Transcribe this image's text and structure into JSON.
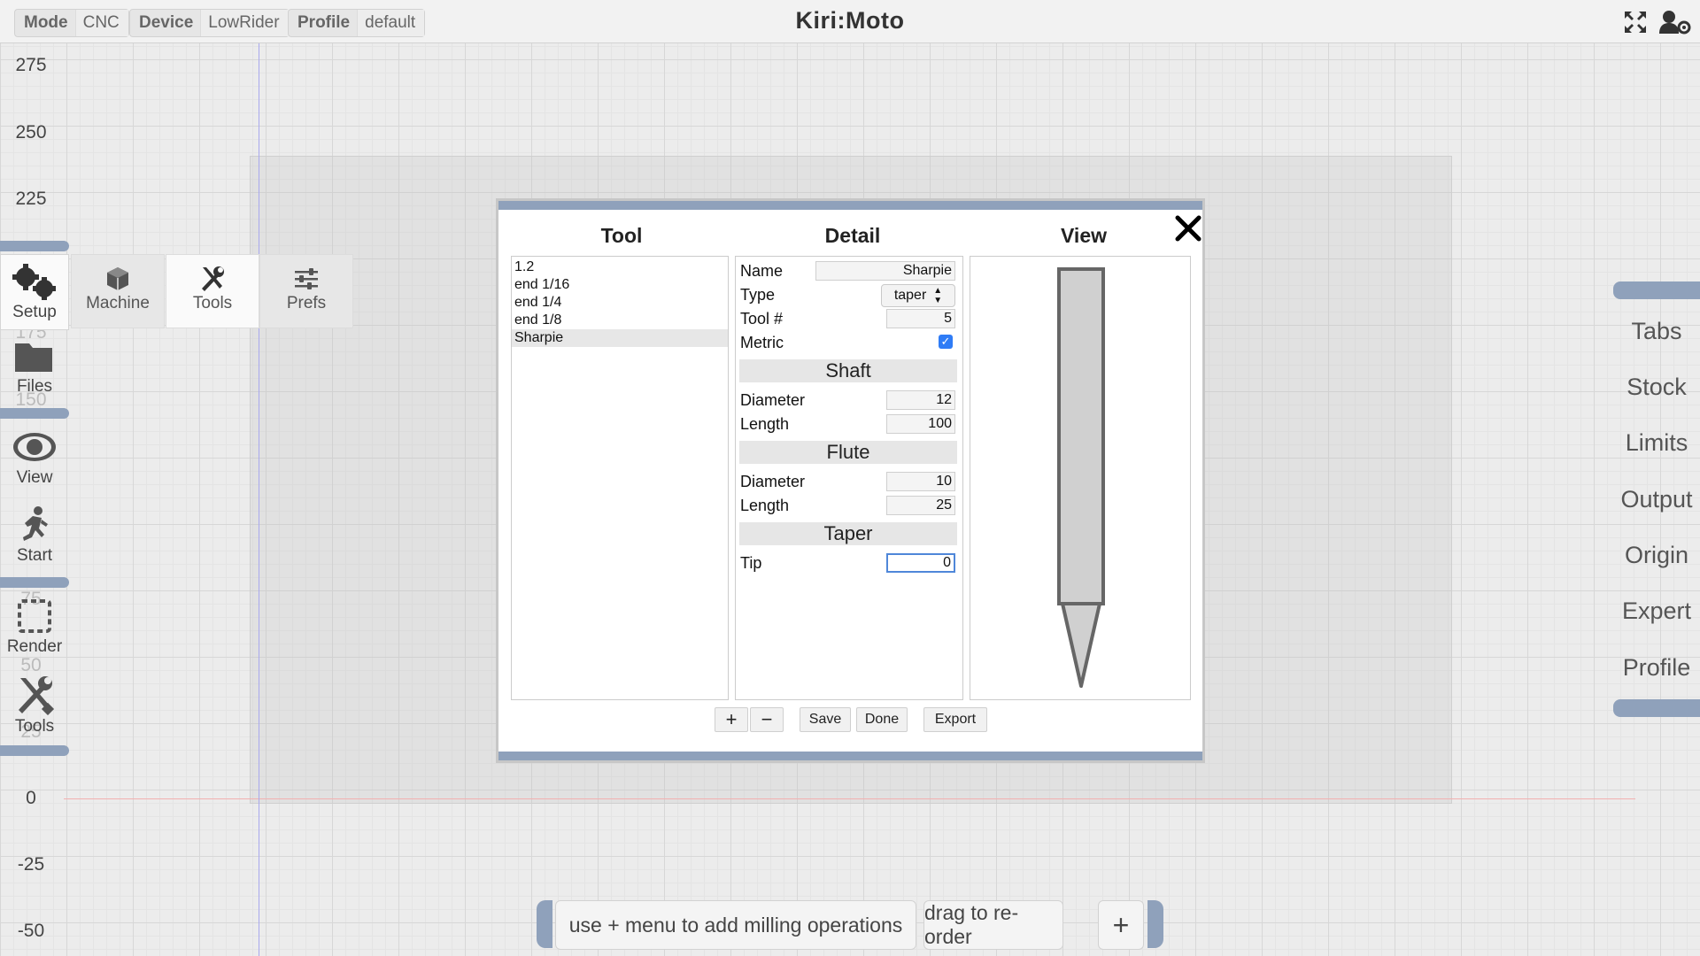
{
  "app": {
    "title": "Kiri:Moto"
  },
  "topbar": {
    "mode": {
      "label": "Mode",
      "value": "CNC"
    },
    "device": {
      "label": "Device",
      "value": "LowRider"
    },
    "profile": {
      "label": "Profile",
      "value": "default"
    },
    "icons": [
      "fullscreen-icon",
      "user-settings-icon"
    ]
  },
  "ruler": {
    "labels": [
      "275",
      "250",
      "225",
      "0",
      "-25",
      "-50"
    ],
    "hidden_labels": [
      "175",
      "150",
      "75",
      "50",
      "25"
    ]
  },
  "left_menu": [
    {
      "label": "Setup",
      "icon": "gears-icon"
    },
    {
      "label": "Files",
      "icon": "folder-icon"
    },
    {
      "label": "View",
      "icon": "eye-icon"
    },
    {
      "label": "Start",
      "icon": "running-person-icon"
    },
    {
      "label": "Render",
      "icon": "render-icon"
    },
    {
      "label": "Tools",
      "icon": "wrench-screwdriver-icon"
    }
  ],
  "setup_submenu": [
    {
      "label": "Machine",
      "icon": "cube-icon"
    },
    {
      "label": "Tools",
      "icon": "tools-icon",
      "active": true
    },
    {
      "label": "Prefs",
      "icon": "sliders-icon"
    }
  ],
  "right_menu": [
    "Tabs",
    "Stock",
    "Limits",
    "Output",
    "Origin",
    "Expert",
    "Profile"
  ],
  "modal": {
    "headers": {
      "tool": "Tool",
      "detail": "Detail",
      "view": "View"
    },
    "tools": [
      "1.2",
      "end 1/16",
      "end 1/4",
      "end 1/8",
      "Sharpie"
    ],
    "selected_tool": "Sharpie",
    "detail": {
      "name": {
        "label": "Name",
        "value": "Sharpie"
      },
      "type": {
        "label": "Type",
        "value": "taper"
      },
      "number": {
        "label": "Tool #",
        "value": "5"
      },
      "metric": {
        "label": "Metric",
        "checked": true
      },
      "shaft": {
        "title": "Shaft",
        "diameter_label": "Diameter",
        "diameter": "12",
        "length_label": "Length",
        "length": "100"
      },
      "flute": {
        "title": "Flute",
        "diameter_label": "Diameter",
        "diameter": "10",
        "length_label": "Length",
        "length": "25"
      },
      "taper": {
        "title": "Taper",
        "tip_label": "Tip",
        "tip": "0"
      }
    },
    "buttons": {
      "add": "+",
      "remove": "−",
      "save": "Save",
      "done": "Done",
      "export": "Export"
    }
  },
  "bottom_bar": {
    "hint": "use + menu to add milling operations",
    "reorder": "drag to re-order",
    "add": "+"
  },
  "colors": {
    "accent": "#8fa1bb",
    "checkbox": "#2f7cf6",
    "x_axis": "#f3b0b0",
    "y_axis": "#a9a9ee"
  }
}
